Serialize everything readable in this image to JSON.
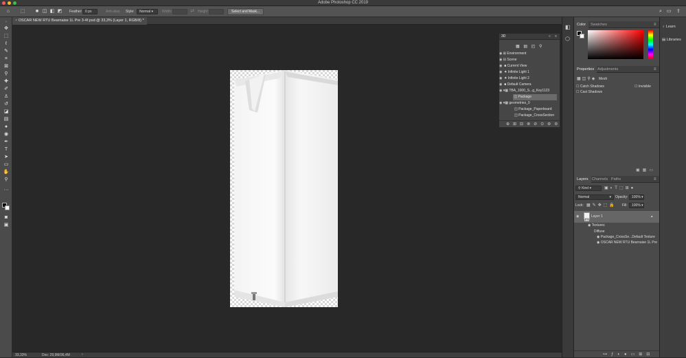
{
  "app": {
    "title": "Adobe Photoshop CC 2019"
  },
  "options_bar": {
    "feather_label": "Feather:",
    "feather_value": "0 px",
    "anti_alias_label": "Anti-alias",
    "style_label": "Style:",
    "style_value": "Normal",
    "width_label": "Width:",
    "height_label": "Height:",
    "select_mask_label": "Select and Mask..."
  },
  "document": {
    "tab_title": "OSCAR NEW RTU Bearnaise 1L Pre 3-4f.psd @ 33,3% (Layer 1, RGB/8) *"
  },
  "status": {
    "zoom": "33,33%",
    "doc_size": "Doc: 29,9M/36,4M"
  },
  "panel_3d": {
    "title": "3D",
    "items": [
      {
        "label": "Environment"
      },
      {
        "label": "Scene"
      },
      {
        "label": "Current View"
      },
      {
        "label": "Infinite Light 1"
      },
      {
        "label": "Infinite Light 2"
      },
      {
        "label": "Default Camera"
      },
      {
        "label": "TBA_1000_S...g_Key1123"
      },
      {
        "label": "Package"
      },
      {
        "label": "geometries_0"
      },
      {
        "label": "Package_Paperboard"
      },
      {
        "label": "Package_CrossSection"
      }
    ]
  },
  "color_panel": {
    "tabs": [
      "Color",
      "Swatches"
    ],
    "foreground": "#000000",
    "background": "#ffffff"
  },
  "properties_panel": {
    "tabs": [
      "Properties",
      "Adjustments"
    ],
    "mode": "Mesh",
    "catch_shadows": "Catch Shadows",
    "cast_shadows": "Cast Shadows",
    "invisible": "Invisible"
  },
  "layers_panel": {
    "tabs": [
      "Layers",
      "Channels",
      "Paths"
    ],
    "kind_label": "Kind",
    "blend_mode": "Normal",
    "opacity_label": "Opacity:",
    "opacity_value": "100%",
    "lock_label": "Lock:",
    "fill_label": "Fill:",
    "fill_value": "100%",
    "layers": [
      {
        "name": "Layer 1"
      },
      {
        "name": "Textures"
      },
      {
        "name": "Diffuse"
      },
      {
        "name": "Package_CrossSe...Default Texture"
      },
      {
        "name": "OSCAR NEW RTU Bearnaise 1L Pre"
      }
    ]
  },
  "right_strip": {
    "learn": "Learn",
    "libraries": "Libraries"
  },
  "colors": {
    "ui_bg": "#282828",
    "panel": "#4a4a4a",
    "selection": "#5f6f86"
  }
}
